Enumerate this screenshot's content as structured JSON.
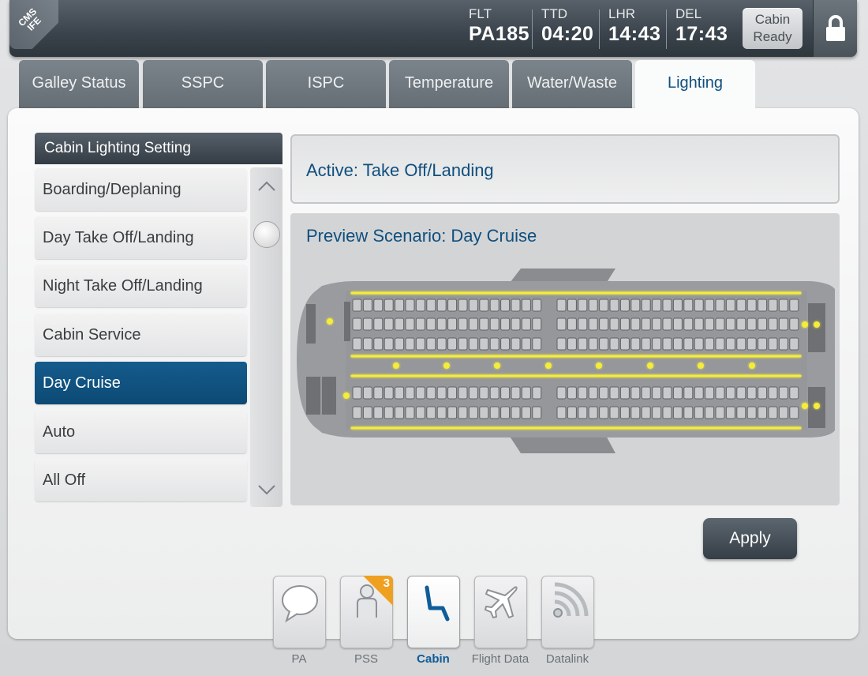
{
  "header": {
    "corner_line1": "CMS",
    "corner_line2": "IFE",
    "flight_label": "FLT",
    "flight_value": "PA185",
    "ttd_label": "TTD",
    "ttd_value": "04:20",
    "origin_label": "LHR",
    "origin_time": "14:43",
    "dest_label": "DEL",
    "dest_time": "17:43",
    "cabin_status_line1": "Cabin",
    "cabin_status_line2": "Ready",
    "lock_icon": "lock-icon"
  },
  "tabs": [
    {
      "label": "Galley Status"
    },
    {
      "label": "SSPC"
    },
    {
      "label": "ISPC"
    },
    {
      "label": "Temperature"
    },
    {
      "label": "Water/Waste"
    },
    {
      "label": "Lighting",
      "active": true
    }
  ],
  "lighting": {
    "list_title": "Cabin Lighting Setting",
    "scenarios": [
      {
        "label": "Boarding/Deplaning"
      },
      {
        "label": "Day Take Off/Landing"
      },
      {
        "label": "Night Take Off/Landing"
      },
      {
        "label": "Cabin Service"
      },
      {
        "label": "Day Cruise",
        "selected": true
      },
      {
        "label": "Auto"
      },
      {
        "label": "All Off"
      }
    ],
    "active_text": "Active: Take Off/Landing",
    "preview_text": "Preview Scenario: Day Cruise",
    "apply_label": "Apply"
  },
  "colors": {
    "accent_blue": "#0d4a75",
    "light_yellow": "#f5ec3a",
    "badge_orange": "#f0a020"
  },
  "bottom_nav": [
    {
      "label": "PA",
      "icon": "speech-bubble-icon"
    },
    {
      "label": "PSS",
      "icon": "person-icon",
      "badge": "3"
    },
    {
      "label": "Cabin",
      "icon": "seat-icon",
      "active": true
    },
    {
      "label": "Flight Data",
      "icon": "airplane-icon"
    },
    {
      "label": "Datalink",
      "icon": "wireless-signal-icon"
    }
  ]
}
